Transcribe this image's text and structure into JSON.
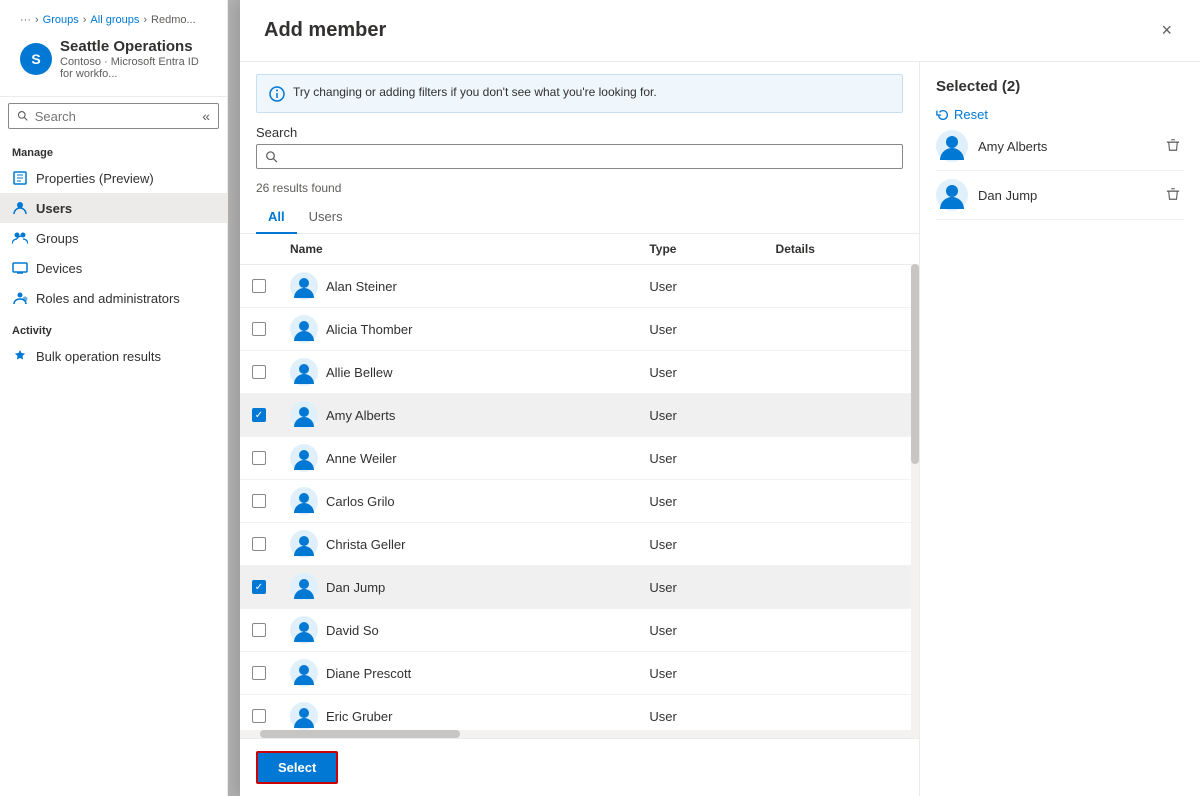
{
  "sidebar": {
    "breadcrumbs": [
      "...",
      "Groups",
      "All groups",
      "Redmo..."
    ],
    "org_name": "Seattle Operations",
    "org_subtitle": "Contoso · Microsoft Entra ID for workfo...",
    "org_initial": "S",
    "search_placeholder": "Search",
    "collapse_icon": "«",
    "manage_label": "Manage",
    "nav_items_manage": [
      {
        "id": "properties",
        "label": "Properties (Preview)",
        "icon": "properties"
      },
      {
        "id": "users",
        "label": "Users",
        "icon": "users",
        "active": true
      },
      {
        "id": "groups",
        "label": "Groups",
        "icon": "groups"
      },
      {
        "id": "devices",
        "label": "Devices",
        "icon": "devices"
      },
      {
        "id": "roles",
        "label": "Roles and administrators",
        "icon": "roles"
      }
    ],
    "activity_label": "Activity",
    "nav_items_activity": [
      {
        "id": "bulk",
        "label": "Bulk operation results",
        "icon": "bulk"
      }
    ]
  },
  "modal": {
    "title": "Add member",
    "close_label": "×",
    "info_banner": "Try changing or adding filters if you don't see what you're looking for.",
    "search_label": "Search",
    "search_placeholder": "",
    "results_count": "26 results found",
    "tabs": [
      {
        "id": "all",
        "label": "All",
        "active": true
      },
      {
        "id": "users",
        "label": "Users",
        "active": false
      }
    ],
    "table": {
      "columns": [
        "",
        "Name",
        "Type",
        "Details"
      ],
      "rows": [
        {
          "name": "Alan Steiner",
          "type": "User",
          "checked": false
        },
        {
          "name": "Alicia Thomber",
          "type": "User",
          "checked": false
        },
        {
          "name": "Allie Bellew",
          "type": "User",
          "checked": false
        },
        {
          "name": "Amy Alberts",
          "type": "User",
          "checked": true,
          "selected": true
        },
        {
          "name": "Anne Weiler",
          "type": "User",
          "checked": false
        },
        {
          "name": "Carlos Grilo",
          "type": "User",
          "checked": false
        },
        {
          "name": "Christa Geller",
          "type": "User",
          "checked": false
        },
        {
          "name": "Dan Jump",
          "type": "User",
          "checked": true,
          "selected": true
        },
        {
          "name": "David So",
          "type": "User",
          "checked": false
        },
        {
          "name": "Diane Prescott",
          "type": "User",
          "checked": false
        },
        {
          "name": "Eric Gruber",
          "type": "User",
          "checked": false
        }
      ]
    },
    "select_button_label": "Select",
    "selected_panel": {
      "title": "Selected (2)",
      "reset_label": "Reset",
      "items": [
        {
          "name": "Amy Alberts"
        },
        {
          "name": "Dan Jump"
        }
      ]
    }
  }
}
